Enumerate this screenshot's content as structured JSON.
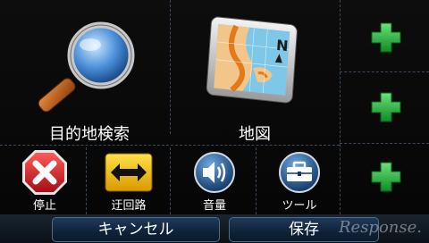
{
  "main_tiles": {
    "search": {
      "label": "目的地検索",
      "icon": "magnifier-icon"
    },
    "map": {
      "label": "地図",
      "icon": "map-icon"
    }
  },
  "quick_tiles": {
    "stop": {
      "label": "停止",
      "icon": "stop-x-icon"
    },
    "detour": {
      "label": "迂回路",
      "icon": "detour-arrows-icon"
    },
    "volume": {
      "label": "音量",
      "icon": "speaker-icon"
    },
    "tools": {
      "label": "ツール",
      "icon": "toolbox-icon"
    }
  },
  "add_slots": [
    "plus-icon",
    "plus-icon",
    "plus-icon"
  ],
  "bottom": {
    "cancel_label": "キャンセル",
    "save_label": "保存"
  },
  "watermark": "Response.",
  "colors": {
    "accent_green": "#22b43a",
    "stop_red": "#d9232a",
    "detour_yellow": "#f4c20d",
    "button_blue": "#163250"
  }
}
